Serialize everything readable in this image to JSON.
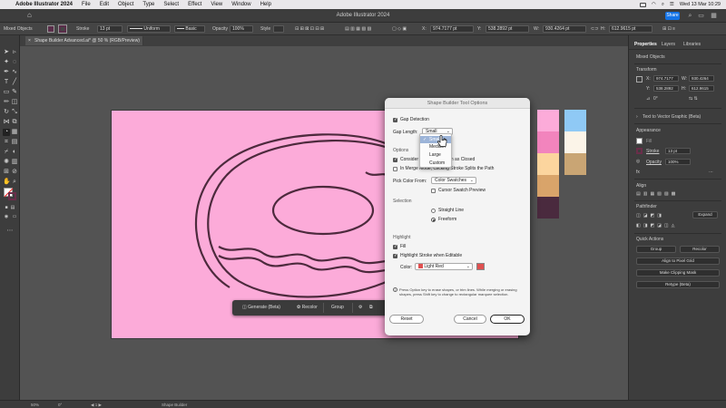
{
  "menubar": {
    "app_name": "Adobe Illustrator 2024",
    "menus": [
      "File",
      "Edit",
      "Object",
      "Type",
      "Select",
      "Effect",
      "View",
      "Window",
      "Help"
    ],
    "datetime": "Wed 13 Mar  10:29"
  },
  "titlebar": {
    "title": "Adobe Illustrator 2024",
    "share_label": "Share"
  },
  "controlbar": {
    "selection_label": "Mixed Objects",
    "stroke_label": "Stroke",
    "stroke_value": "13 pt",
    "profile_value": "Uniform",
    "brush_value": "Basic",
    "opacity_label": "Opacity",
    "opacity_value": "100%",
    "style_label": "Style",
    "x_value": "974.7177 pt",
    "y_value": "538.2892 pt",
    "w_value": "930.4264 pt",
    "h_value": "612.9615 pt"
  },
  "doctab": {
    "label": "Shape Builder Advanced.ai* @ 50 % (RGB/Preview)"
  },
  "colors": {
    "artboard": "#fcabd9",
    "donut_stroke": "#4d2a3d",
    "palette_col1": [
      "#fcabd9",
      "#f284bd",
      "#fcd59e",
      "#d9a46a",
      "#4a2a3e"
    ],
    "palette_col2": [
      "#8fc9f5",
      "#fbf4e8",
      "#c9a574"
    ],
    "accent": "#1473e6"
  },
  "taskbar": {
    "generate_label": "Generate (Beta)",
    "recolor_label": "Recolor",
    "group_label": "Group"
  },
  "panel": {
    "tabs": [
      "Properties",
      "Layers",
      "Libraries"
    ],
    "selection_label": "Mixed Objects",
    "transform_label": "Transform",
    "x_label": "X:",
    "x_value": "974.7177",
    "y_label": "Y:",
    "y_value": "538.2892",
    "w_label": "W:",
    "w_value": "930.4264",
    "h_label": "H:",
    "h_value": "612.9615",
    "angle_value": "0°",
    "text_to_vector": "Text to Vector Graphic (Beta)",
    "appearance_label": "Appearance",
    "fill_label": "Fill",
    "stroke_label": "Stroke",
    "stroke_value": "13 pt",
    "opacity_label": "Opacity",
    "opacity_value": "100%",
    "align_label": "Align",
    "pathfinder_label": "Pathfinder",
    "expand_label": "Expand",
    "quick_actions_label": "Quick Actions",
    "group_btn": "Group",
    "recolor_btn": "Recolor",
    "align_pixel_btn": "Align to Pixel Grid",
    "clipping_btn": "Make Clipping Mask",
    "retype_btn": "Retype (Beta)"
  },
  "statusbar": {
    "zoom": "50%",
    "angle": "0°",
    "tool": "Shape Builder"
  },
  "dialog": {
    "title": "Shape Builder Tool Options",
    "gap_detection": "Gap Detection",
    "gap_length_label": "Gap Length:",
    "gap_length_value": "Small",
    "options_label": "Options",
    "consider_label": "Consider Open Filled Path as Closed",
    "merge_label": "In Merge Mode, Clicking Stroke Splits the Path",
    "pick_color_label": "Pick Color From:",
    "pick_color_value": "Color Swatches",
    "cursor_swatch_label": "Cursor Swatch Preview",
    "selection_label": "Selection",
    "straight_line_label": "Straight Line",
    "freeform_label": "Freeform",
    "highlight_label": "Highlight",
    "fill_label": "Fill",
    "highlight_stroke_label": "Highlight Stroke when Editable",
    "color_label": "Color:",
    "color_value": "Light Red",
    "note": "Press Option key to erase shapes, or trim lines. While merging or erasing shapes, press Shift key to change to rectangular marquee selection.",
    "reset_label": "Reset",
    "cancel_label": "Cancel",
    "ok_label": "OK"
  },
  "gap_popup": {
    "options": [
      "Small",
      "Medium",
      "Large",
      "Custom"
    ],
    "selected": "Small"
  }
}
